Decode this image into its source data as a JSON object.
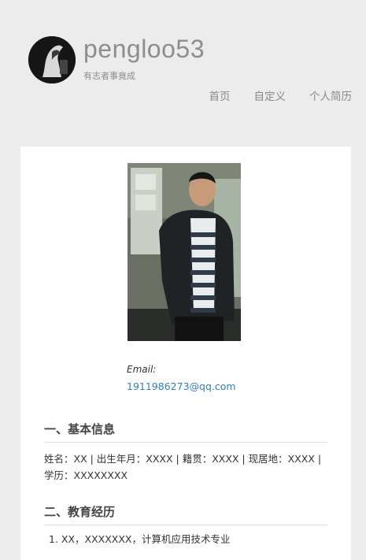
{
  "site": {
    "title": "pengloo53",
    "tagline": "有志者事竟成"
  },
  "nav": {
    "items": [
      {
        "label": "首页"
      },
      {
        "label": "自定义"
      },
      {
        "label": "个人简历"
      }
    ]
  },
  "profile": {
    "email_label": "Email:",
    "email": "1911986273@qq.com"
  },
  "sections": {
    "basic": {
      "heading": "一、基本信息",
      "body": "姓名：XX | 出生年月：XXXX | 籍贯：XXXX | 现居地：XXXX | 学历：XXXXXXXX"
    },
    "education": {
      "heading": "二、教育经历",
      "items": [
        "1. XX，XXXXXXX，计算机应用技术专业"
      ]
    }
  }
}
